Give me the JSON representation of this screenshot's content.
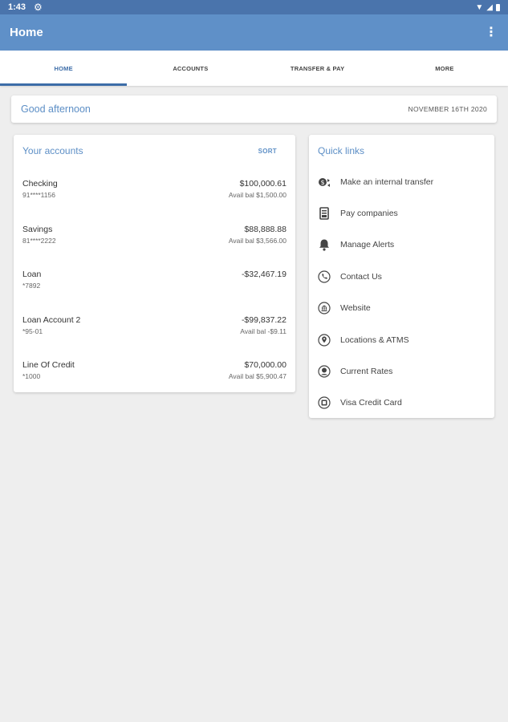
{
  "status_bar": {
    "time": "1:43",
    "gear_icon": "gear-icon"
  },
  "app_bar": {
    "title": "Home",
    "overflow_icon": "more-vert-icon"
  },
  "tabs": [
    {
      "label": "HOME",
      "active": true
    },
    {
      "label": "ACCOUNTS",
      "active": false
    },
    {
      "label": "TRANSFER & PAY",
      "active": false
    },
    {
      "label": "MORE",
      "active": false
    }
  ],
  "greeting": {
    "text": "Good afternoon",
    "date": "NOVEMBER 16TH 2020"
  },
  "accounts": {
    "title": "Your accounts",
    "sort_label": "SORT",
    "items": [
      {
        "name": "Checking",
        "number": "91****1156",
        "balance": "$100,000.61",
        "avail": "Avail bal $1,500.00"
      },
      {
        "name": "Savings",
        "number": "81****2222",
        "balance": "$88,888.88",
        "avail": "Avail bal $3,566.00"
      },
      {
        "name": "Loan",
        "number": "*7892",
        "balance": "-$32,467.19",
        "avail": ""
      },
      {
        "name": "Loan Account 2",
        "number": "*95-01",
        "balance": "-$99,837.22",
        "avail": "Avail bal -$9.11"
      },
      {
        "name": "Line Of Credit",
        "number": "*1000",
        "balance": "$70,000.00",
        "avail": "Avail bal $5,900.47"
      }
    ]
  },
  "quick_links": {
    "title": "Quick links",
    "items": [
      {
        "label": "Make an internal transfer",
        "icon": "transfer-icon"
      },
      {
        "label": "Pay companies",
        "icon": "bill-icon"
      },
      {
        "label": "Manage Alerts",
        "icon": "bell-icon"
      },
      {
        "label": "Contact Us",
        "icon": "phone-icon"
      },
      {
        "label": "Website",
        "icon": "bank-icon"
      },
      {
        "label": "Locations & ATMS",
        "icon": "location-pin-icon"
      },
      {
        "label": "Current Rates",
        "icon": "rates-icon"
      },
      {
        "label": "Visa Credit Card",
        "icon": "credit-card-icon"
      }
    ]
  },
  "colors": {
    "status_bar": "#4a74ac",
    "app_bar": "#5f90c8",
    "accent": "#3d6da8",
    "link_text": "#5d8fc6",
    "background": "#eeeeee"
  }
}
